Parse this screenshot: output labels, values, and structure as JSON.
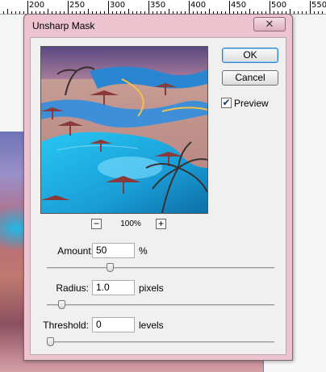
{
  "ruler": {
    "labels": [
      "200",
      "250",
      "300",
      "350",
      "400",
      "450",
      "500",
      "550"
    ]
  },
  "dialog": {
    "title": "Unsharp Mask",
    "close_label": "✕",
    "ok_label": "OK",
    "cancel_label": "Cancel",
    "preview": {
      "label": "Preview",
      "checked": true
    },
    "zoom": {
      "minus": "−",
      "plus": "+",
      "level": "100%"
    }
  },
  "params": {
    "amount": {
      "label": "Amount:",
      "value": "50",
      "unit": "%",
      "slider_fraction": 0.27
    },
    "radius": {
      "label": "Radius:",
      "value": "1.0",
      "unit": "pixels",
      "slider_fraction": 0.05
    },
    "threshold": {
      "label": "Threshold:",
      "value": "0",
      "unit": "levels",
      "slider_fraction": 0.0
    }
  },
  "colors": {
    "dialog_frame": "#ecc3cf",
    "client_bg": "#f0f0f0",
    "ok_accent": "#2d80c4",
    "pool": "#1fb8e8"
  }
}
